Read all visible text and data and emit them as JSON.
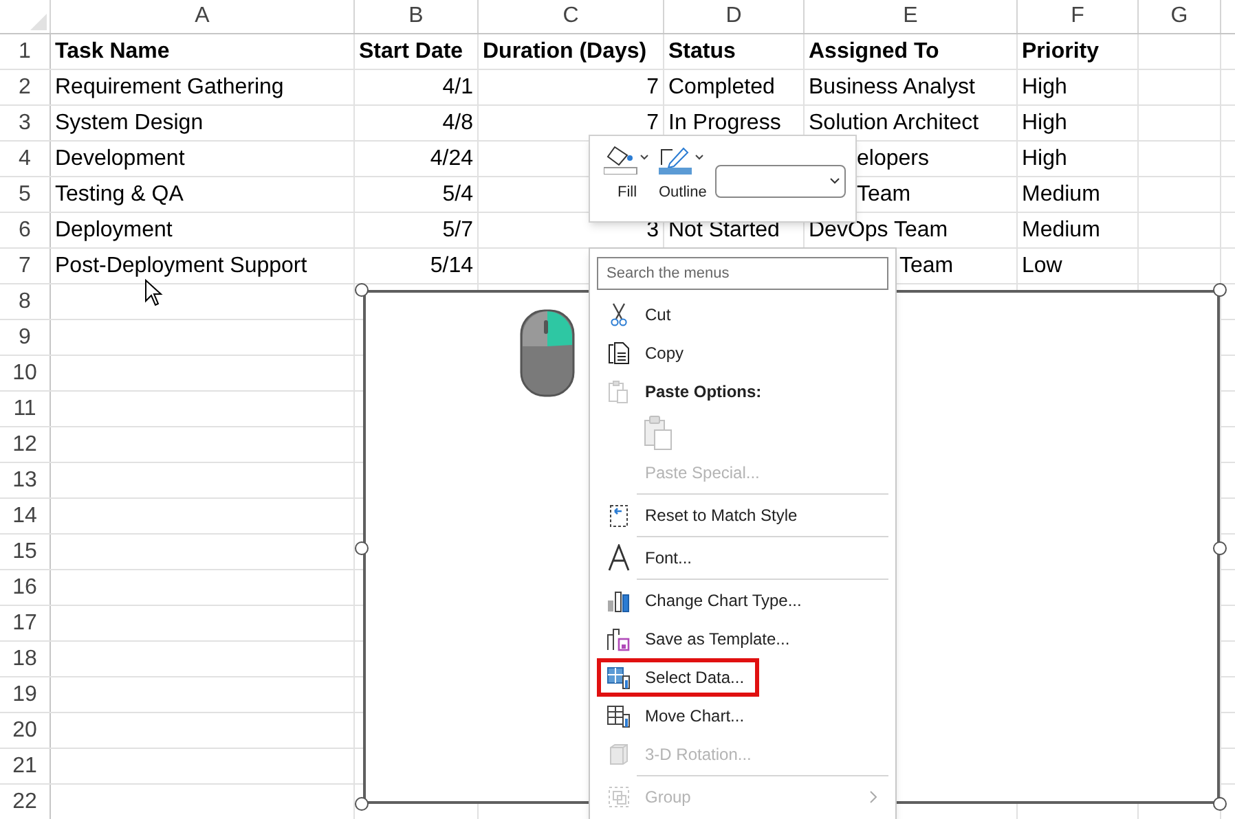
{
  "columns": [
    "A",
    "B",
    "C",
    "D",
    "E",
    "F",
    "G"
  ],
  "rows": [
    {
      "number": "1",
      "cells": [
        {
          "text": "Task Name"
        },
        {
          "text": "Start Date"
        },
        {
          "text": "Duration (Days)"
        },
        {
          "text": "Status"
        },
        {
          "text": "Assigned To"
        },
        {
          "text": "Priority"
        }
      ]
    },
    {
      "number": "2",
      "cells": [
        {
          "text": "Requirement Gathering"
        },
        {
          "text": "4/1"
        },
        {
          "text": "7"
        },
        {
          "text": "Completed"
        },
        {
          "text": "Business Analyst"
        },
        {
          "text": "High"
        }
      ]
    },
    {
      "number": "3",
      "cells": [
        {
          "text": "System Design"
        },
        {
          "text": "4/8"
        },
        {
          "text": "7"
        },
        {
          "text": "In Progress"
        },
        {
          "text": "Solution Architect"
        },
        {
          "text": "High"
        }
      ]
    },
    {
      "number": "4",
      "cells": [
        {
          "text": "Development"
        },
        {
          "text": "4/24"
        },
        null,
        null,
        {
          "text": "elopers"
        },
        {
          "text": "High"
        }
      ]
    },
    {
      "number": "5",
      "cells": [
        {
          "text": "Testing & QA"
        },
        {
          "text": "5/4"
        },
        null,
        null,
        {
          "text": "Team"
        },
        {
          "text": "Medium"
        }
      ]
    },
    {
      "number": "6",
      "cells": [
        {
          "text": "Deployment"
        },
        {
          "text": "5/7"
        },
        {
          "text": "3"
        },
        {
          "text": "Not Started"
        },
        {
          "text": "DevOps Team"
        },
        {
          "text": "Medium"
        }
      ]
    },
    {
      "number": "7",
      "cells": [
        {
          "text": "Post-Deployment Support"
        },
        {
          "text": "5/14"
        },
        null,
        null,
        {
          "text": "Team"
        },
        {
          "text": "Low"
        }
      ]
    },
    {
      "number": "8"
    },
    {
      "number": "9"
    },
    {
      "number": "10"
    },
    {
      "number": "11"
    },
    {
      "number": "12"
    },
    {
      "number": "13"
    },
    {
      "number": "14"
    },
    {
      "number": "15"
    },
    {
      "number": "16"
    },
    {
      "number": "17"
    },
    {
      "number": "18"
    },
    {
      "number": "19"
    },
    {
      "number": "20"
    },
    {
      "number": "21"
    },
    {
      "number": "22"
    }
  ],
  "mini_toolbar": {
    "buttons": [
      {
        "label": "Fill"
      },
      {
        "label": "Outline"
      }
    ]
  },
  "context_menu": {
    "search": {
      "placeholder": "Search the menus"
    },
    "items": [
      {
        "kind": "item",
        "label": "Cut",
        "disabled": false,
        "highlighted": false,
        "submenu": false
      },
      {
        "kind": "item",
        "label": "Copy",
        "disabled": false,
        "highlighted": false,
        "submenu": false
      },
      {
        "kind": "heading",
        "label": "Paste Options:"
      },
      {
        "kind": "paste"
      },
      {
        "kind": "item",
        "label": "Paste Special...",
        "disabled": true,
        "highlighted": false,
        "submenu": false
      },
      {
        "kind": "separator"
      },
      {
        "kind": "item",
        "label": "Reset to Match Style",
        "disabled": false,
        "highlighted": false,
        "submenu": false
      },
      {
        "kind": "separator"
      },
      {
        "kind": "item",
        "label": "Font...",
        "disabled": false,
        "highlighted": false,
        "submenu": false
      },
      {
        "kind": "separator"
      },
      {
        "kind": "item",
        "label": "Change Chart Type...",
        "disabled": false,
        "highlighted": false,
        "submenu": false
      },
      {
        "kind": "item",
        "label": "Save as Template...",
        "disabled": false,
        "highlighted": false,
        "submenu": false
      },
      {
        "kind": "item",
        "label": "Select Data...",
        "disabled": false,
        "highlighted": true,
        "submenu": false
      },
      {
        "kind": "item",
        "label": "Move Chart...",
        "disabled": false,
        "highlighted": false,
        "submenu": false
      },
      {
        "kind": "item",
        "label": "3-D Rotation...",
        "disabled": true,
        "highlighted": false,
        "submenu": false
      },
      {
        "kind": "separator"
      },
      {
        "kind": "item",
        "label": "Group",
        "disabled": true,
        "highlighted": false,
        "submenu": true
      }
    ]
  }
}
